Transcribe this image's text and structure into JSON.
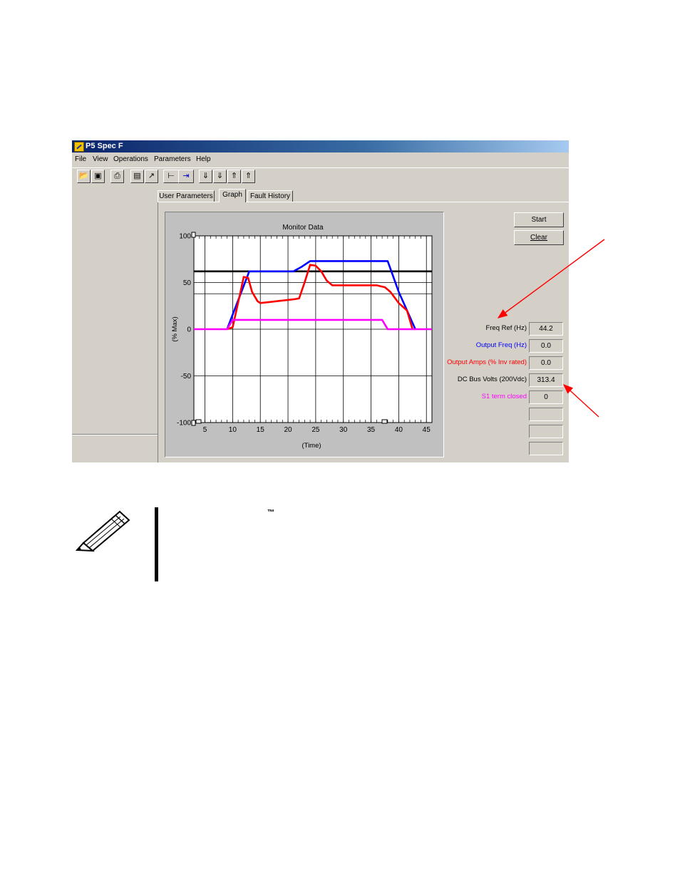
{
  "window": {
    "title": "P5 Spec F",
    "menu": [
      "File",
      "View",
      "Operations",
      "Parameters",
      "Help"
    ],
    "toolbar_icons": [
      "open-icon",
      "save-icon",
      "print-icon",
      "doc-icon",
      "chart-icon",
      "step-left-icon",
      "step-right-icon",
      "download-icon",
      "download-all-icon",
      "upload-icon",
      "upload-all-icon"
    ],
    "tabs": [
      {
        "label": "User Parameters",
        "active": false
      },
      {
        "label": "Graph",
        "active": true
      },
      {
        "label": "Fault History",
        "active": false
      }
    ],
    "buttons": {
      "start": "Start",
      "clear": "Clear"
    },
    "monitor": [
      {
        "label": "Freq Ref (Hz)",
        "value": "44.2",
        "color": "#000000"
      },
      {
        "label": "Output Freq (Hz)",
        "value": "0.0",
        "color": "#0000ff"
      },
      {
        "label": "Output Amps (% Inv rated)",
        "value": "0.0",
        "color": "#ff0000"
      },
      {
        "label": "DC Bus Volts (200Vdc)",
        "value": "313.4",
        "color": "#000000"
      },
      {
        "label": "S1 term closed",
        "value": "0",
        "color": "#ff00ff"
      },
      {
        "label": "",
        "value": "",
        "color": "#000000"
      },
      {
        "label": "",
        "value": "",
        "color": "#000000"
      },
      {
        "label": "",
        "value": "",
        "color": "#000000"
      }
    ]
  },
  "chart_data": {
    "type": "line",
    "title": "Monitor Data",
    "xlabel": "(Time)",
    "ylabel": "(% Max)",
    "xlim": [
      3,
      46
    ],
    "ylim": [
      -100,
      100
    ],
    "xticks": [
      5,
      10,
      15,
      20,
      25,
      30,
      35,
      40,
      45
    ],
    "yticks": [
      100,
      50,
      0,
      -50,
      -100
    ],
    "extra_grid_y": [
      62,
      38
    ],
    "grid": true,
    "series": [
      {
        "color": "#000000",
        "points": [
          [
            3,
            62
          ],
          [
            46,
            62
          ]
        ]
      },
      {
        "color": "#0000ff",
        "points": [
          [
            9,
            0
          ],
          [
            13,
            62
          ],
          [
            21,
            62
          ],
          [
            22.5,
            67
          ],
          [
            24,
            73
          ],
          [
            38,
            73
          ],
          [
            40,
            40
          ],
          [
            43,
            0
          ]
        ]
      },
      {
        "color": "#ff0000",
        "points": [
          [
            9,
            0
          ],
          [
            10,
            2
          ],
          [
            11.5,
            42
          ],
          [
            12,
            56
          ],
          [
            12.8,
            55
          ],
          [
            13.5,
            40
          ],
          [
            14.5,
            30
          ],
          [
            15,
            28
          ],
          [
            18,
            30
          ],
          [
            21,
            32
          ],
          [
            22,
            33
          ],
          [
            23,
            50
          ],
          [
            24,
            69
          ],
          [
            25,
            68
          ],
          [
            26,
            62
          ],
          [
            27,
            52
          ],
          [
            28,
            47
          ],
          [
            32,
            47
          ],
          [
            36,
            47
          ],
          [
            37.5,
            45
          ],
          [
            38.5,
            40
          ],
          [
            40,
            28
          ],
          [
            41.5,
            20
          ],
          [
            42.5,
            0
          ]
        ]
      },
      {
        "color": "#ff00ff",
        "points": [
          [
            3,
            0
          ],
          [
            9,
            0
          ],
          [
            10,
            10
          ],
          [
            37,
            10
          ],
          [
            38,
            0
          ],
          [
            46,
            0
          ]
        ]
      }
    ]
  },
  "note": {
    "trademark": "™"
  }
}
